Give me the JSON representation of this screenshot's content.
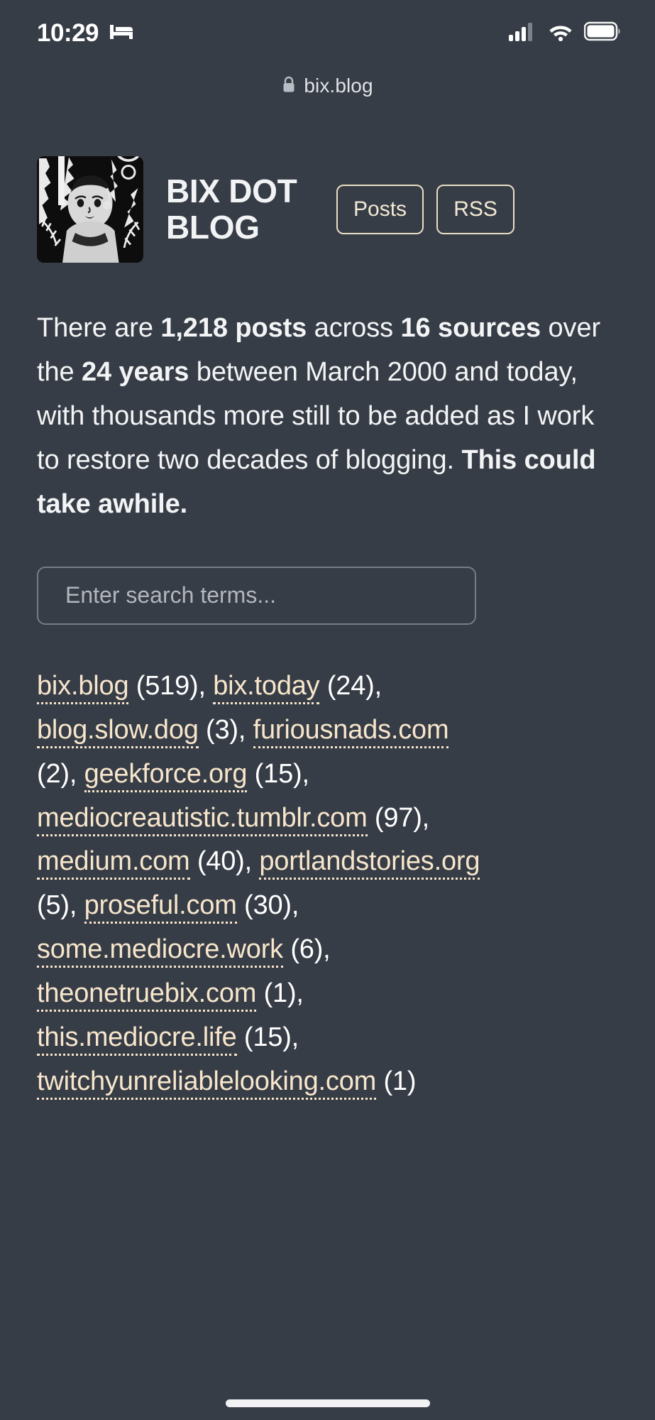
{
  "status_bar": {
    "time": "10:29",
    "sleep_icon": "bed-icon",
    "cellular_icon": "cellular-signal-icon",
    "wifi_icon": "wifi-icon",
    "battery_icon": "battery-icon"
  },
  "browser": {
    "lock_icon": "lock-icon",
    "url": "bix.blog"
  },
  "header": {
    "logo_alt": "site-logo",
    "title": "BIX DOT BLOG",
    "nav": [
      {
        "label": "Posts"
      },
      {
        "label": "RSS"
      }
    ]
  },
  "intro": {
    "part1": "There are ",
    "bold1": "1,218 posts",
    "part2": " across ",
    "bold2": "16 sources",
    "part3": " over the ",
    "bold3": "24 years",
    "part4": " between March 2000 and today, with thousands more still to be added as I work to restore two decades of blogging. ",
    "bold4": "This could take awhile."
  },
  "search": {
    "placeholder": "Enter search terms...",
    "value": ""
  },
  "sources": {
    "items": [
      {
        "name": "bix.blog",
        "count": "(519)"
      },
      {
        "name": "bix.today",
        "count": "(24)"
      },
      {
        "name": "blog.slow.dog",
        "count": "(3)"
      },
      {
        "name": "furiousnads.com",
        "count": "(2)"
      },
      {
        "name": "geekforce.org",
        "count": "(15)"
      },
      {
        "name": "mediocreautistic.tumblr.com",
        "count": "(97)"
      },
      {
        "name": "medium.com",
        "count": "(40)"
      },
      {
        "name": "portlandstories.org",
        "count": "(5)"
      },
      {
        "name": "proseful.com",
        "count": "(30)"
      },
      {
        "name": "some.mediocre.work",
        "count": "(6)"
      },
      {
        "name": "theonetruebix.com",
        "count": "(1)"
      },
      {
        "name": "this.mediocre.life",
        "count": "(15)"
      },
      {
        "name": "twitchyunreliablelooking.com",
        "count": "(1)"
      }
    ],
    "separator": ", "
  },
  "colors": {
    "background": "#373d47",
    "accent": "#f7e6cb",
    "text": "#f3f4f5"
  }
}
